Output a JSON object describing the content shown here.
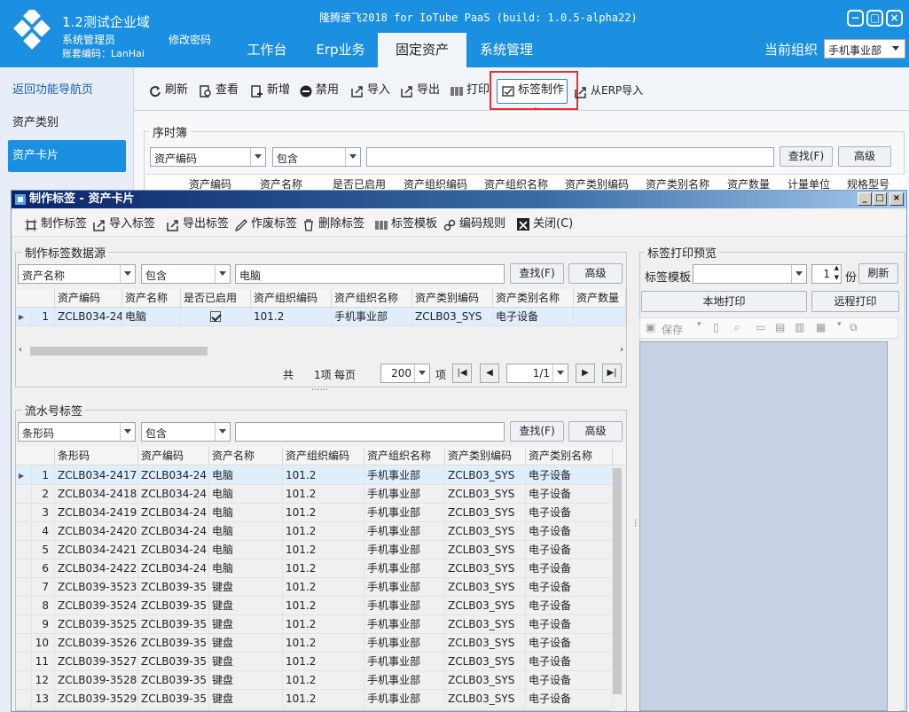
{
  "header": {
    "org_name": "1.2测试企业域",
    "user_role": "系统管理员",
    "account": "账套编码：LanHai",
    "change_password": "修改密码",
    "app_title": "隆腾速飞2018 for IoTube PaaS (build: 1.0.5-alpha22)",
    "tabs": [
      {
        "label": "工作台"
      },
      {
        "label": "Erp业务"
      },
      {
        "label": "固定资产"
      },
      {
        "label": "系统管理"
      }
    ],
    "current_org_label": "当前组织",
    "current_org_value": "手机事业部",
    "brand_color": "#1b8fe0"
  },
  "sidebar": {
    "items": [
      {
        "label": "返回功能导航页"
      },
      {
        "label": "资产类别"
      },
      {
        "label": "资产卡片"
      }
    ]
  },
  "main_toolbar": {
    "refresh": "刷新",
    "view": "查看",
    "add": "新增",
    "disable": "禁用",
    "import": "导入",
    "export": "导出",
    "print": "打印",
    "make_label": "标签制作",
    "erp_import": "从ERP导入"
  },
  "bg_panel": {
    "title": "序时簿",
    "field": "资产编码",
    "op": "包含",
    "search": "查找(F)",
    "advanced": "高级",
    "columns": [
      "资产编码",
      "资产名称",
      "是否已启用",
      "资产组织编码",
      "资产组织名称",
      "资产类别编码",
      "资产类别名称",
      "资产数量",
      "计量单位",
      "规格型号"
    ]
  },
  "dialog": {
    "title": "制作标签 - 资产卡片",
    "toolbar": {
      "make": "制作标签",
      "import": "导入标签",
      "export": "导出标签",
      "void": "作废标签",
      "delete": "删除标签",
      "template": "标签模板",
      "rule": "编码规则",
      "close": "关闭(C)"
    },
    "source": {
      "title": "制作标签数据源",
      "field": "资产名称",
      "op": "包含",
      "value": "电脑",
      "search": "查找(F)",
      "advanced": "高级",
      "columns": [
        "资产编码",
        "资产名称",
        "是否已启用",
        "资产组织编码",
        "资产组织名称",
        "资产类别编码",
        "资产类别名称",
        "资产数量"
      ],
      "rows": [
        {
          "n": "1",
          "code": "ZCLB034-24",
          "name": "电脑",
          "enabled": true,
          "org_code": "101.2",
          "org_name": "手机事业部",
          "cat_code": "ZCLB03_SYS",
          "cat_name": "电子设备",
          "qty": ""
        }
      ],
      "pager": {
        "total_prefix": "共",
        "count": "1项",
        "per_page_label": "每页",
        "page_size": "200",
        "unit": "项",
        "page": "1/1"
      }
    },
    "serial": {
      "title": "流水号标签",
      "field": "条形码",
      "op": "包含",
      "value": "",
      "search": "查找(F)",
      "advanced": "高级",
      "columns": [
        "条形码",
        "资产编码",
        "资产名称",
        "资产组织编码",
        "资产组织名称",
        "资产类别编码",
        "资产类别名称"
      ],
      "rows": [
        {
          "n": "1",
          "barcode": "ZCLB034-2417",
          "code": "ZCLB034-24",
          "name": "电脑",
          "org_code": "101.2",
          "org_name": "手机事业部",
          "cat_code": "ZCLB03_SYS",
          "cat_name": "电子设备"
        },
        {
          "n": "2",
          "barcode": "ZCLB034-2418",
          "code": "ZCLB034-24",
          "name": "电脑",
          "org_code": "101.2",
          "org_name": "手机事业部",
          "cat_code": "ZCLB03_SYS",
          "cat_name": "电子设备"
        },
        {
          "n": "3",
          "barcode": "ZCLB034-2419",
          "code": "ZCLB034-24",
          "name": "电脑",
          "org_code": "101.2",
          "org_name": "手机事业部",
          "cat_code": "ZCLB03_SYS",
          "cat_name": "电子设备"
        },
        {
          "n": "4",
          "barcode": "ZCLB034-2420",
          "code": "ZCLB034-24",
          "name": "电脑",
          "org_code": "101.2",
          "org_name": "手机事业部",
          "cat_code": "ZCLB03_SYS",
          "cat_name": "电子设备"
        },
        {
          "n": "5",
          "barcode": "ZCLB034-2421",
          "code": "ZCLB034-24",
          "name": "电脑",
          "org_code": "101.2",
          "org_name": "手机事业部",
          "cat_code": "ZCLB03_SYS",
          "cat_name": "电子设备"
        },
        {
          "n": "6",
          "barcode": "ZCLB034-2422",
          "code": "ZCLB034-24",
          "name": "电脑",
          "org_code": "101.2",
          "org_name": "手机事业部",
          "cat_code": "ZCLB03_SYS",
          "cat_name": "电子设备"
        },
        {
          "n": "7",
          "barcode": "ZCLB039-3523",
          "code": "ZCLB039-35",
          "name": "键盘",
          "org_code": "101.2",
          "org_name": "手机事业部",
          "cat_code": "ZCLB03_SYS",
          "cat_name": "电子设备"
        },
        {
          "n": "8",
          "barcode": "ZCLB039-3524",
          "code": "ZCLB039-35",
          "name": "键盘",
          "org_code": "101.2",
          "org_name": "手机事业部",
          "cat_code": "ZCLB03_SYS",
          "cat_name": "电子设备"
        },
        {
          "n": "9",
          "barcode": "ZCLB039-3525",
          "code": "ZCLB039-35",
          "name": "键盘",
          "org_code": "101.2",
          "org_name": "手机事业部",
          "cat_code": "ZCLB03_SYS",
          "cat_name": "电子设备"
        },
        {
          "n": "10",
          "barcode": "ZCLB039-3526",
          "code": "ZCLB039-35",
          "name": "键盘",
          "org_code": "101.2",
          "org_name": "手机事业部",
          "cat_code": "ZCLB03_SYS",
          "cat_name": "电子设备"
        },
        {
          "n": "11",
          "barcode": "ZCLB039-3527",
          "code": "ZCLB039-35",
          "name": "键盘",
          "org_code": "101.2",
          "org_name": "手机事业部",
          "cat_code": "ZCLB03_SYS",
          "cat_name": "电子设备"
        },
        {
          "n": "12",
          "barcode": "ZCLB039-3528",
          "code": "ZCLB039-35",
          "name": "键盘",
          "org_code": "101.2",
          "org_name": "手机事业部",
          "cat_code": "ZCLB03_SYS",
          "cat_name": "电子设备"
        },
        {
          "n": "13",
          "barcode": "ZCLB039-3529",
          "code": "ZCLB039-35",
          "name": "键盘",
          "org_code": "101.2",
          "org_name": "手机事业部",
          "cat_code": "ZCLB03_SYS",
          "cat_name": "电子设备"
        }
      ]
    },
    "preview": {
      "title": "标签打印预览",
      "template_label": "标签模板",
      "template_value": "",
      "copies": "1",
      "copies_unit": "份",
      "refresh": "刷新",
      "local_print": "本地打印",
      "remote_print": "远程打印",
      "save": "保存"
    }
  }
}
